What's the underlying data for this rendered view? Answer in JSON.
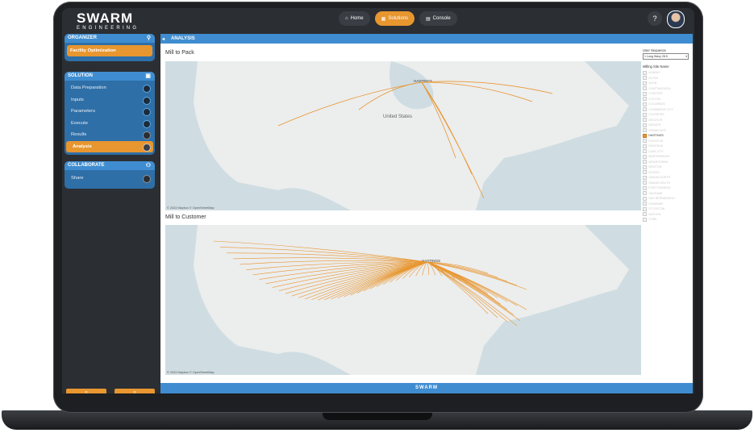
{
  "app": {
    "brand_main": "SWARM",
    "brand_sub": "ENGINEERING",
    "footer_brand": "SWARM"
  },
  "nav": {
    "home": "Home",
    "solutions": "Solutions",
    "console": "Console",
    "help": "?"
  },
  "organizer": {
    "title": "ORGANIZER",
    "item": "Facility Optimization"
  },
  "solution": {
    "title": "SOLUTION",
    "items": [
      "Data Preparation",
      "Inputs",
      "Parameters",
      "Execute",
      "Results",
      "Analysis"
    ]
  },
  "collaborate": {
    "title": "COLLABORATE",
    "items": [
      "Share"
    ]
  },
  "pager": {
    "prev": "«",
    "next": "»"
  },
  "main": {
    "header": "ANALYSIS"
  },
  "maps": [
    {
      "title": "Mill to Pack",
      "credit": "© 2023 Mapbox  © OpenStreetMap",
      "labels": {
        "hub": "HASTINGS",
        "country": "United States"
      }
    },
    {
      "title": "Mill to Customer",
      "credit": "© 2023 Mapbox  © OpenStreetMap",
      "labels": {
        "hub": "HASTINGS"
      }
    }
  ],
  "filters": {
    "sequence_label": "User Sequence",
    "sequence_value": "1 Long Wavy 28.5",
    "site_label": "Milling Site Name",
    "sites": [
      "ALBANY",
      "ALTON",
      "AVON",
      "CHATTANOOGA",
      "CHESTER",
      "COLTON",
      "COLUMBUS",
      "COMMERCE CITY",
      "CULPEPER",
      "DECATUR",
      "DENVER",
      "FRANKFURT",
      "HASTINGS",
      "HOUSTON",
      "KENOSHA",
      "LAKE CITY",
      "MARTINSBURG",
      "MINNETONKA",
      "NEWTON",
      "OGDEN",
      "OMAHA NORTH",
      "OMAHA SOUTH",
      "PORT READING",
      "SAGINAW",
      "SAN BERNARDINO",
      "SHAWNEE",
      "STOCKTON",
      "WICHITA",
      "YORK"
    ],
    "selected": "HASTINGS"
  },
  "colors": {
    "accent": "#e8962f",
    "primary": "#3f8dd0"
  }
}
